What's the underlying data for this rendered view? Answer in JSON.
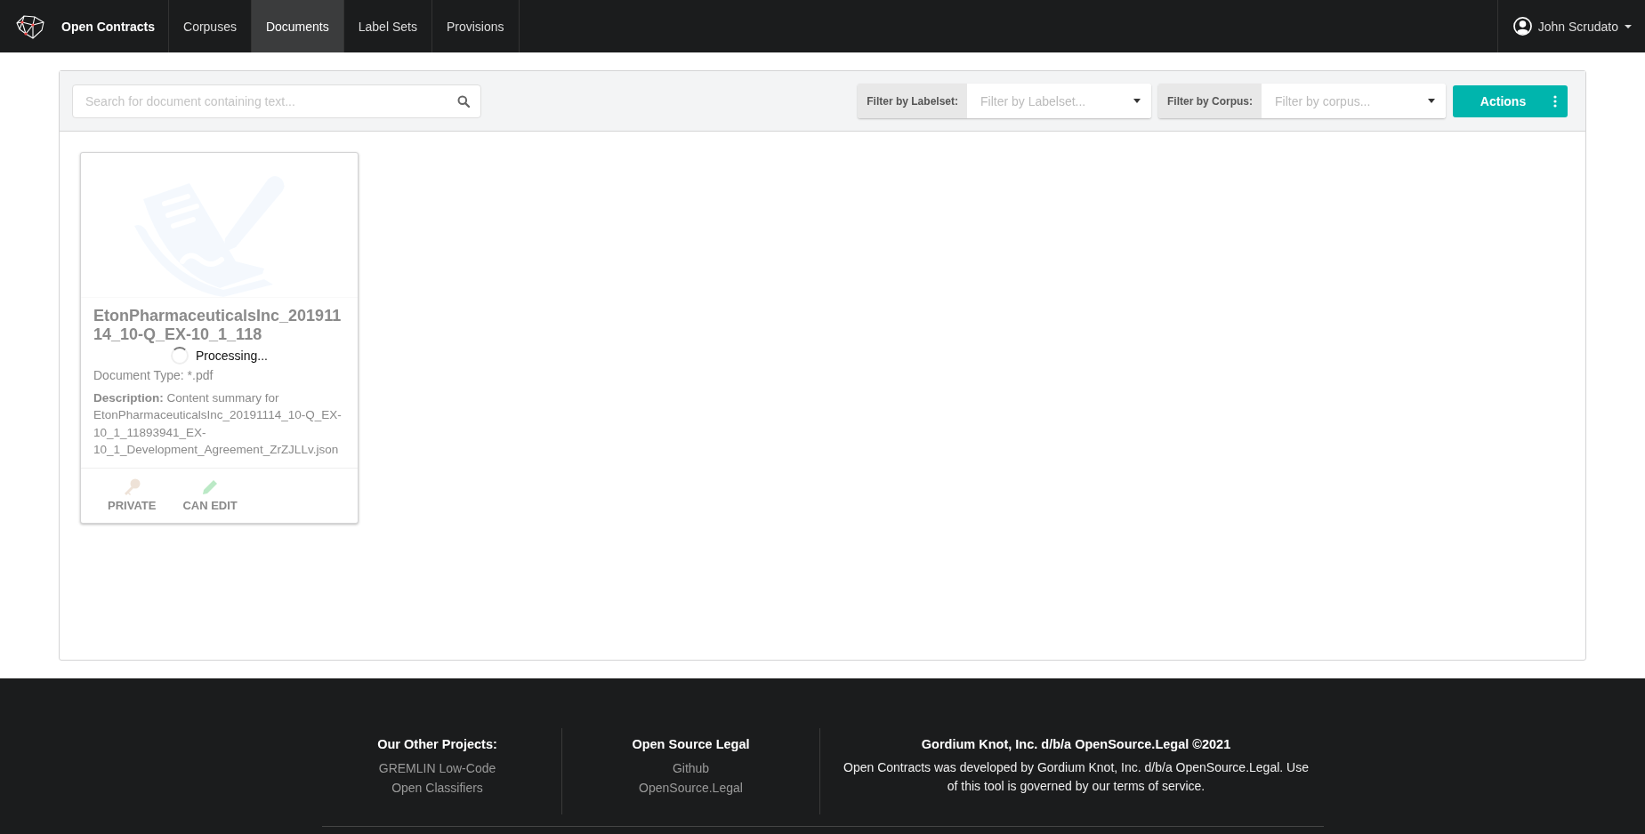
{
  "navbar": {
    "brand": "Open Contracts",
    "tabs": [
      {
        "label": "Corpuses",
        "selected": false
      },
      {
        "label": "Documents",
        "selected": true
      },
      {
        "label": "Label Sets",
        "selected": false
      },
      {
        "label": "Provisions",
        "selected": false
      }
    ],
    "user": "John Scrudato"
  },
  "toolbar": {
    "search": {
      "placeholder": "Search for document containing text..."
    },
    "filters": [
      {
        "label": "Filter by Labelset:",
        "placeholder": "Filter by Labelset..."
      },
      {
        "label": "Filter by Corpus:",
        "placeholder": "Filter by corpus..."
      }
    ],
    "actions_button": "Actions"
  },
  "documents": [
    {
      "title": "EtonPharmaceuticalsInc_20191114_10-Q_EX-10_1_118",
      "document_type": "Document Type: *.pdf",
      "description": "**Description:** Content summary for EtonPharmaceuticalsInc_20191114_10-Q_EX-10_1_11893941_EX-10_1_Development_Agreement_ZrZJLLv.json",
      "processing": true,
      "processing_text": "Processing...",
      "badges": [
        {
          "kind": "private",
          "label": "PRIVATE"
        },
        {
          "kind": "edit",
          "label": "CAN EDIT"
        }
      ]
    }
  ],
  "footer": {
    "columns": [
      {
        "heading": "Our Other Projects:",
        "links": [
          "GREMLIN Low-Code",
          "Open Classifiers"
        ]
      },
      {
        "heading": "Open Source Legal",
        "links": [
          "Github",
          "OpenSource.Legal"
        ]
      }
    ],
    "company": {
      "heading": "Gordium Knot, Inc. d/b/a OpenSource.Legal ©2021",
      "text": "Open Contracts was developed by Gordium Knot, Inc. d/b/a OpenSource.Legal. Use of this tool is governed by our terms of service."
    }
  }
}
